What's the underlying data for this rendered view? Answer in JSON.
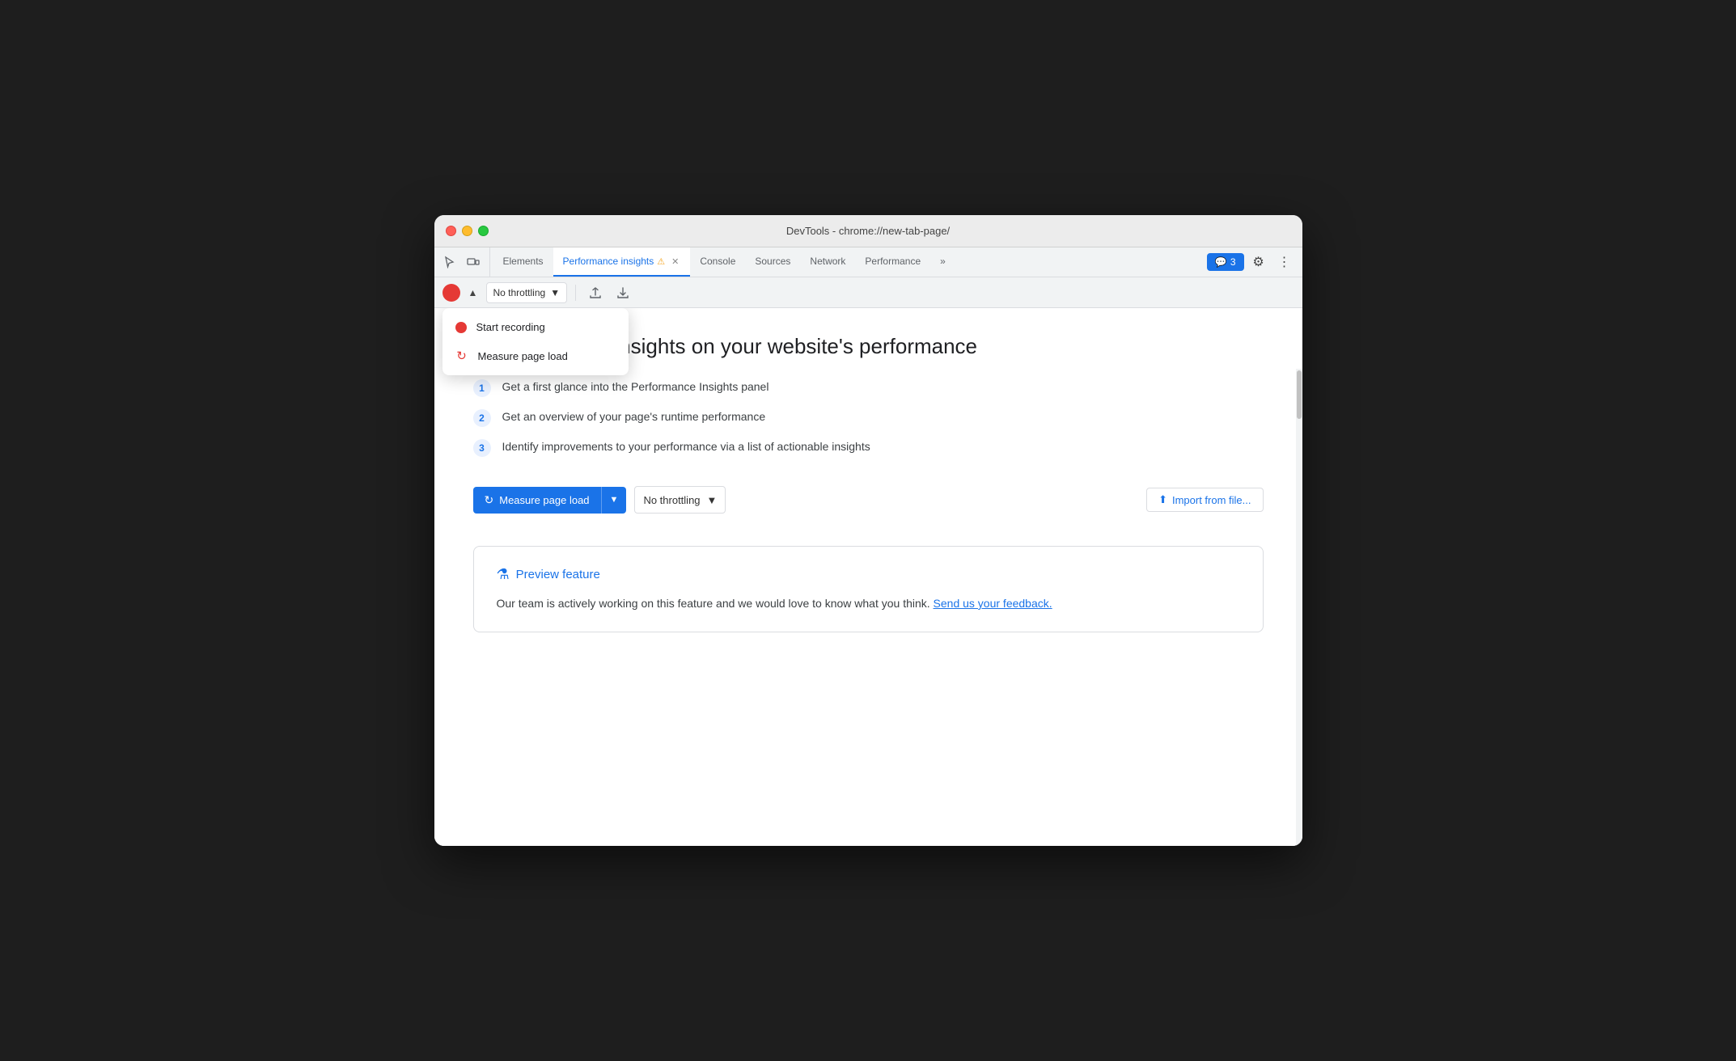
{
  "titlebar": {
    "title": "DevTools - chrome://new-tab-page/"
  },
  "tabs": {
    "items": [
      {
        "id": "elements",
        "label": "Elements",
        "active": false
      },
      {
        "id": "performance-insights",
        "label": "Performance insights",
        "active": true,
        "closable": true,
        "warning": true
      },
      {
        "id": "console",
        "label": "Console",
        "active": false
      },
      {
        "id": "sources",
        "label": "Sources",
        "active": false
      },
      {
        "id": "network",
        "label": "Network",
        "active": false
      },
      {
        "id": "performance",
        "label": "Performance",
        "active": false
      }
    ],
    "more_label": "»",
    "chat_count": "3",
    "settings_icon": "⚙",
    "more_icon": "⋮"
  },
  "toolbar": {
    "throttle_label": "No throttling",
    "upload_icon": "↑",
    "download_icon": "↓"
  },
  "dropdown": {
    "start_recording": "Start recording",
    "measure_page_load": "Measure page load"
  },
  "content": {
    "heading": "Get actionable insights on your website's performance",
    "steps": [
      {
        "num": "1",
        "text": "Get a first glance into the Performance Insights panel"
      },
      {
        "num": "2",
        "text": "Get an overview of your page's runtime performance"
      },
      {
        "num": "3",
        "text": "Identify improvements to your performance via a list of actionable insights"
      }
    ],
    "measure_btn": "Measure page load",
    "throttle_main_label": "No throttling",
    "import_btn": "Import from file...",
    "preview_title": "Preview feature",
    "preview_body": "Our team is actively working on this feature and we would love to know what you think.",
    "feedback_link": "Send us your feedback."
  },
  "icons": {
    "record": "●",
    "caret_up": "▲",
    "caret_down": "▼",
    "reload": "↻",
    "flask": "⚗",
    "upload": "⬆",
    "download": "⬇",
    "chat": "💬"
  }
}
